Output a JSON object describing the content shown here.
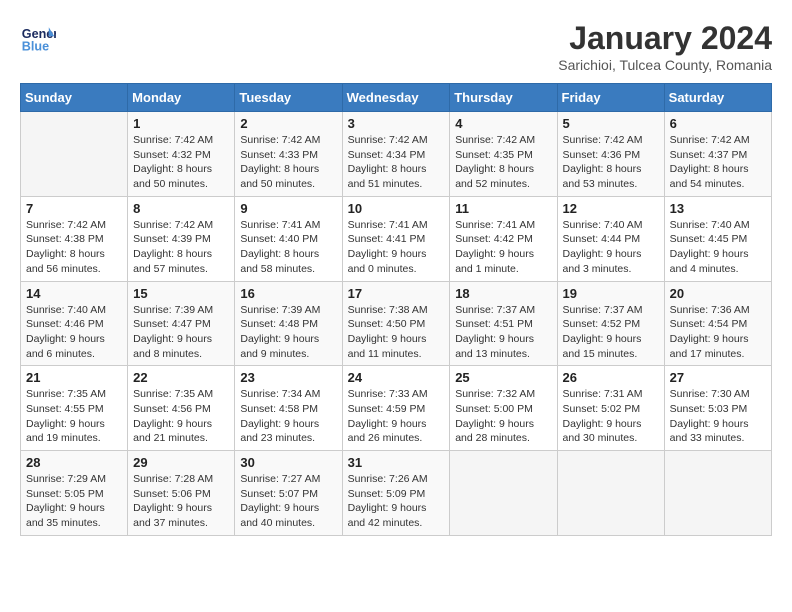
{
  "header": {
    "logo_line1": "General",
    "logo_line2": "Blue",
    "title": "January 2024",
    "subtitle": "Sarichioi, Tulcea County, Romania"
  },
  "weekdays": [
    "Sunday",
    "Monday",
    "Tuesday",
    "Wednesday",
    "Thursday",
    "Friday",
    "Saturday"
  ],
  "weeks": [
    [
      {
        "day": "",
        "info": ""
      },
      {
        "day": "1",
        "info": "Sunrise: 7:42 AM\nSunset: 4:32 PM\nDaylight: 8 hours\nand 50 minutes."
      },
      {
        "day": "2",
        "info": "Sunrise: 7:42 AM\nSunset: 4:33 PM\nDaylight: 8 hours\nand 50 minutes."
      },
      {
        "day": "3",
        "info": "Sunrise: 7:42 AM\nSunset: 4:34 PM\nDaylight: 8 hours\nand 51 minutes."
      },
      {
        "day": "4",
        "info": "Sunrise: 7:42 AM\nSunset: 4:35 PM\nDaylight: 8 hours\nand 52 minutes."
      },
      {
        "day": "5",
        "info": "Sunrise: 7:42 AM\nSunset: 4:36 PM\nDaylight: 8 hours\nand 53 minutes."
      },
      {
        "day": "6",
        "info": "Sunrise: 7:42 AM\nSunset: 4:37 PM\nDaylight: 8 hours\nand 54 minutes."
      }
    ],
    [
      {
        "day": "7",
        "info": "Sunrise: 7:42 AM\nSunset: 4:38 PM\nDaylight: 8 hours\nand 56 minutes."
      },
      {
        "day": "8",
        "info": "Sunrise: 7:42 AM\nSunset: 4:39 PM\nDaylight: 8 hours\nand 57 minutes."
      },
      {
        "day": "9",
        "info": "Sunrise: 7:41 AM\nSunset: 4:40 PM\nDaylight: 8 hours\nand 58 minutes."
      },
      {
        "day": "10",
        "info": "Sunrise: 7:41 AM\nSunset: 4:41 PM\nDaylight: 9 hours\nand 0 minutes."
      },
      {
        "day": "11",
        "info": "Sunrise: 7:41 AM\nSunset: 4:42 PM\nDaylight: 9 hours\nand 1 minute."
      },
      {
        "day": "12",
        "info": "Sunrise: 7:40 AM\nSunset: 4:44 PM\nDaylight: 9 hours\nand 3 minutes."
      },
      {
        "day": "13",
        "info": "Sunrise: 7:40 AM\nSunset: 4:45 PM\nDaylight: 9 hours\nand 4 minutes."
      }
    ],
    [
      {
        "day": "14",
        "info": "Sunrise: 7:40 AM\nSunset: 4:46 PM\nDaylight: 9 hours\nand 6 minutes."
      },
      {
        "day": "15",
        "info": "Sunrise: 7:39 AM\nSunset: 4:47 PM\nDaylight: 9 hours\nand 8 minutes."
      },
      {
        "day": "16",
        "info": "Sunrise: 7:39 AM\nSunset: 4:48 PM\nDaylight: 9 hours\nand 9 minutes."
      },
      {
        "day": "17",
        "info": "Sunrise: 7:38 AM\nSunset: 4:50 PM\nDaylight: 9 hours\nand 11 minutes."
      },
      {
        "day": "18",
        "info": "Sunrise: 7:37 AM\nSunset: 4:51 PM\nDaylight: 9 hours\nand 13 minutes."
      },
      {
        "day": "19",
        "info": "Sunrise: 7:37 AM\nSunset: 4:52 PM\nDaylight: 9 hours\nand 15 minutes."
      },
      {
        "day": "20",
        "info": "Sunrise: 7:36 AM\nSunset: 4:54 PM\nDaylight: 9 hours\nand 17 minutes."
      }
    ],
    [
      {
        "day": "21",
        "info": "Sunrise: 7:35 AM\nSunset: 4:55 PM\nDaylight: 9 hours\nand 19 minutes."
      },
      {
        "day": "22",
        "info": "Sunrise: 7:35 AM\nSunset: 4:56 PM\nDaylight: 9 hours\nand 21 minutes."
      },
      {
        "day": "23",
        "info": "Sunrise: 7:34 AM\nSunset: 4:58 PM\nDaylight: 9 hours\nand 23 minutes."
      },
      {
        "day": "24",
        "info": "Sunrise: 7:33 AM\nSunset: 4:59 PM\nDaylight: 9 hours\nand 26 minutes."
      },
      {
        "day": "25",
        "info": "Sunrise: 7:32 AM\nSunset: 5:00 PM\nDaylight: 9 hours\nand 28 minutes."
      },
      {
        "day": "26",
        "info": "Sunrise: 7:31 AM\nSunset: 5:02 PM\nDaylight: 9 hours\nand 30 minutes."
      },
      {
        "day": "27",
        "info": "Sunrise: 7:30 AM\nSunset: 5:03 PM\nDaylight: 9 hours\nand 33 minutes."
      }
    ],
    [
      {
        "day": "28",
        "info": "Sunrise: 7:29 AM\nSunset: 5:05 PM\nDaylight: 9 hours\nand 35 minutes."
      },
      {
        "day": "29",
        "info": "Sunrise: 7:28 AM\nSunset: 5:06 PM\nDaylight: 9 hours\nand 37 minutes."
      },
      {
        "day": "30",
        "info": "Sunrise: 7:27 AM\nSunset: 5:07 PM\nDaylight: 9 hours\nand 40 minutes."
      },
      {
        "day": "31",
        "info": "Sunrise: 7:26 AM\nSunset: 5:09 PM\nDaylight: 9 hours\nand 42 minutes."
      },
      {
        "day": "",
        "info": ""
      },
      {
        "day": "",
        "info": ""
      },
      {
        "day": "",
        "info": ""
      }
    ]
  ]
}
